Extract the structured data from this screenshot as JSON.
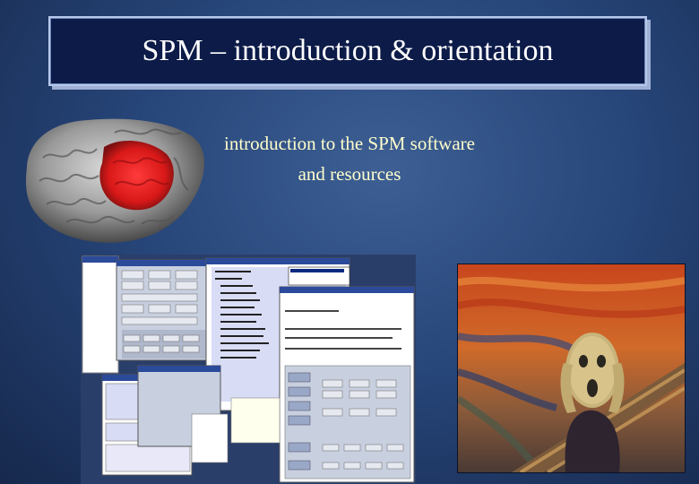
{
  "slide": {
    "title": "SPM – introduction & orientation",
    "subtitle_line1": "introduction to the SPM software",
    "subtitle_line2": "and resources"
  },
  "images": {
    "brain": "brain-render-icon",
    "collage": "spm-software-windows-screenshot",
    "scream": "the-scream-painting"
  },
  "colors": {
    "title_bg": "#0c1b48",
    "title_text": "#ffffff",
    "subtitle_text": "#ffffcc",
    "background": "#27467a"
  }
}
